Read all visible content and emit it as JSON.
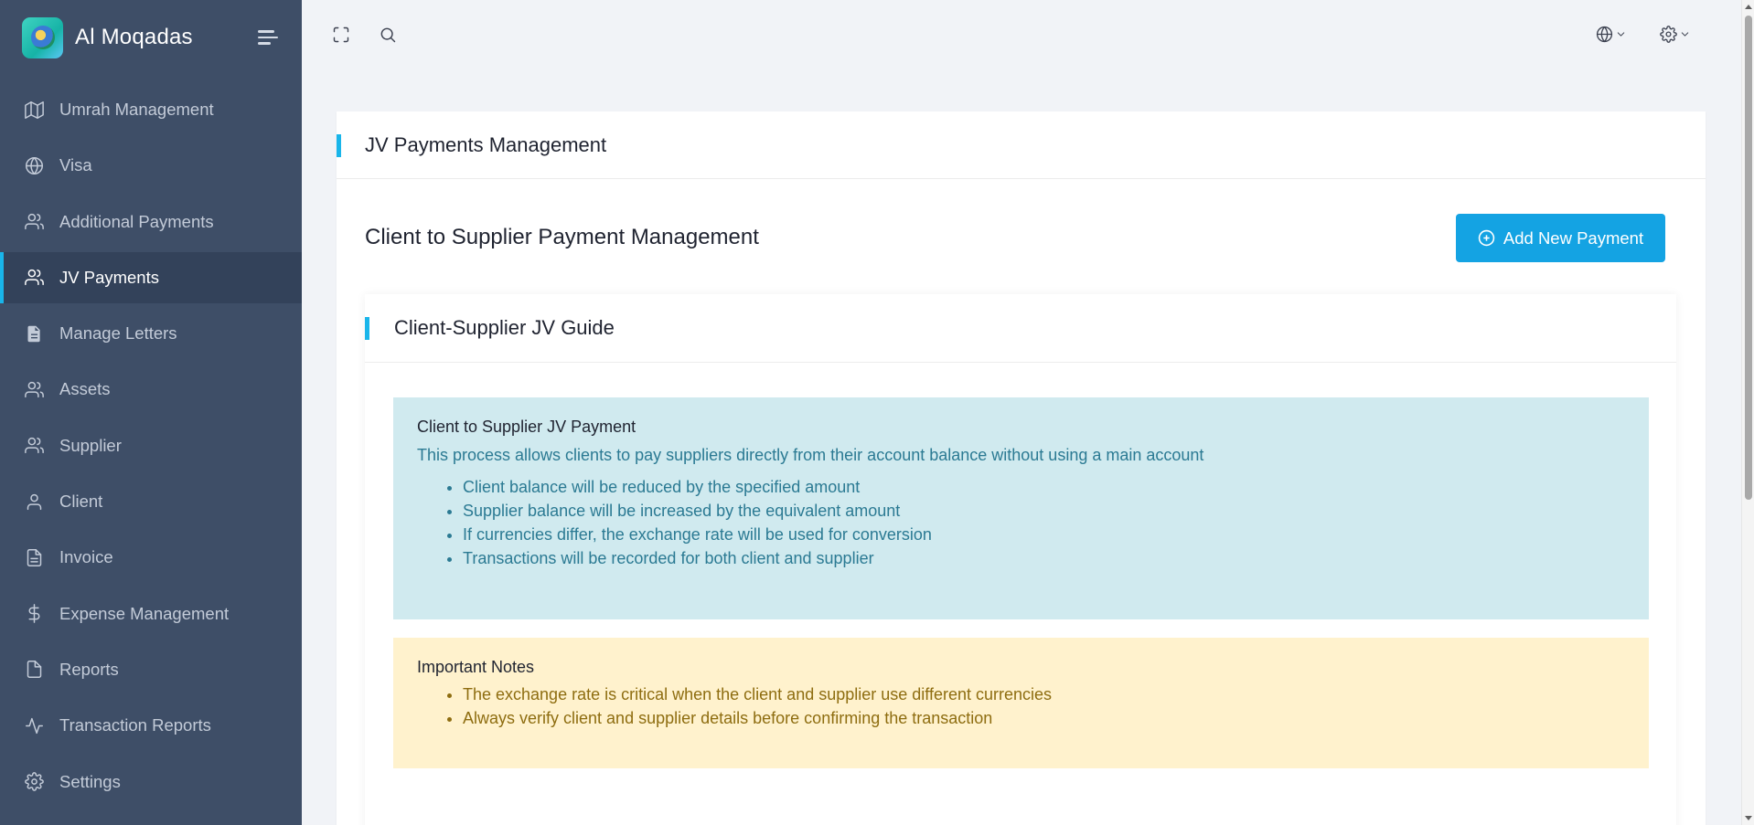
{
  "brand": {
    "name": "Al Moqadas"
  },
  "sidebar": {
    "items": [
      {
        "label": "Umrah Management",
        "icon": "map-icon"
      },
      {
        "label": "Visa",
        "icon": "globe-icon"
      },
      {
        "label": "Additional Payments",
        "icon": "users-icon"
      },
      {
        "label": "JV Payments",
        "icon": "users-icon",
        "active": true
      },
      {
        "label": "Manage Letters",
        "icon": "document-icon"
      },
      {
        "label": "Assets",
        "icon": "users-icon"
      },
      {
        "label": "Supplier",
        "icon": "users-icon"
      },
      {
        "label": "Client",
        "icon": "user-icon"
      },
      {
        "label": "Invoice",
        "icon": "file-text-icon"
      },
      {
        "label": "Expense Management",
        "icon": "dollar-icon"
      },
      {
        "label": "Reports",
        "icon": "file-icon"
      },
      {
        "label": "Transaction Reports",
        "icon": "activity-icon"
      },
      {
        "label": "Settings",
        "icon": "gear-icon"
      }
    ]
  },
  "topbar": {
    "icons": [
      "fullscreen-icon",
      "search-icon",
      "globe-icon",
      "gear-icon"
    ]
  },
  "page": {
    "title": "JV Payments Management",
    "section_title": "Client to Supplier Payment Management",
    "add_button_label": "Add New Payment"
  },
  "guide": {
    "title": "Client-Supplier JV Guide",
    "info": {
      "heading": "Client to Supplier JV Payment",
      "text": "This process allows clients to pay suppliers directly from their account balance without using a main account",
      "items": [
        "Client balance will be reduced by the specified amount",
        "Supplier balance will be increased by the equivalent amount",
        "If currencies differ, the exchange rate will be used for conversion",
        "Transactions will be recorded for both client and supplier"
      ]
    },
    "notes": {
      "heading": "Important Notes",
      "items": [
        "The exchange rate is critical when the client and supplier use different currencies",
        "Always verify client and supplier details before confirming the transaction"
      ]
    }
  },
  "colors": {
    "sidebar_bg": "#3e4e67",
    "sidebar_active_bg": "#33425a",
    "accent": "#19b5ea",
    "button": "#14a3e3",
    "info_bg": "#d0eaef",
    "warn_bg": "#fff2cd"
  }
}
